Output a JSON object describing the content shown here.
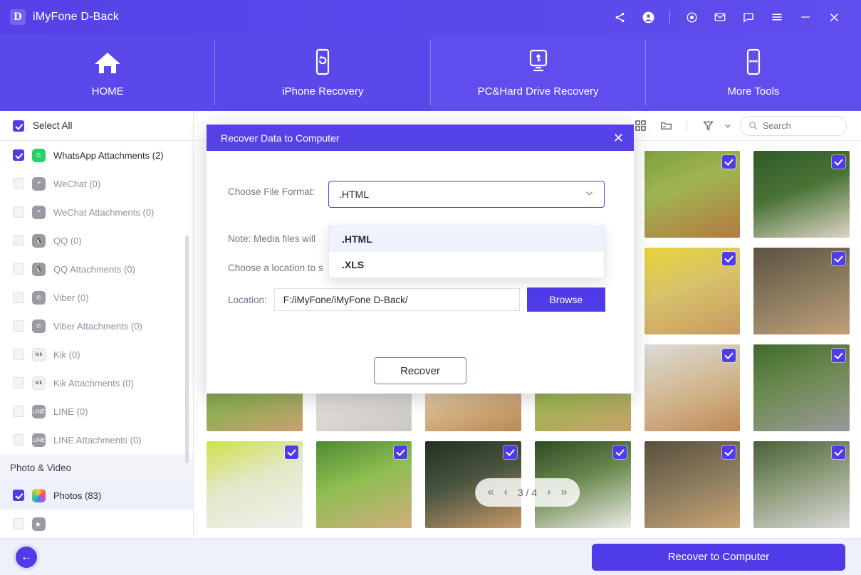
{
  "window": {
    "title": "iMyFone D-Back",
    "logo_letter": "D",
    "controls": [
      {
        "name": "share-icon"
      },
      {
        "name": "account-icon"
      },
      {
        "name": "target-icon"
      },
      {
        "name": "mail-icon"
      },
      {
        "name": "chat-icon"
      },
      {
        "name": "menu-icon"
      },
      {
        "name": "minimize-icon"
      },
      {
        "name": "close-icon"
      }
    ]
  },
  "nav": {
    "tabs": [
      {
        "label": "HOME",
        "icon": "home-icon",
        "active": true
      },
      {
        "label": "iPhone Recovery",
        "icon": "phone-refresh-icon",
        "active": false
      },
      {
        "label": "PC&Hard Drive Recovery",
        "icon": "monitor-key-icon",
        "active": false
      },
      {
        "label": "More Tools",
        "icon": "more-dots-icon",
        "active": false
      }
    ]
  },
  "sidebar": {
    "select_all_label": "Select All",
    "select_all_checked": true,
    "items": [
      {
        "label": "WhatsApp Attachments (2)",
        "checked": true,
        "enabled": true,
        "icon": "whatsapp-icon"
      },
      {
        "label": "WeChat (0)",
        "checked": false,
        "enabled": false,
        "icon": "wechat-icon"
      },
      {
        "label": "WeChat Attachments (0)",
        "checked": false,
        "enabled": false,
        "icon": "wechat-icon"
      },
      {
        "label": "QQ (0)",
        "checked": false,
        "enabled": false,
        "icon": "qq-icon"
      },
      {
        "label": "QQ Attachments (0)",
        "checked": false,
        "enabled": false,
        "icon": "qq-icon"
      },
      {
        "label": "Viber (0)",
        "checked": false,
        "enabled": false,
        "icon": "viber-icon"
      },
      {
        "label": "Viber Attachments (0)",
        "checked": false,
        "enabled": false,
        "icon": "viber-icon"
      },
      {
        "label": "Kik (0)",
        "checked": false,
        "enabled": false,
        "icon": "kik-icon"
      },
      {
        "label": "Kik Attachments (0)",
        "checked": false,
        "enabled": false,
        "icon": "kik-icon"
      },
      {
        "label": "LINE (0)",
        "checked": false,
        "enabled": false,
        "icon": "line-icon"
      },
      {
        "label": "LINE Attachments (0)",
        "checked": false,
        "enabled": false,
        "icon": "line-icon"
      }
    ],
    "group_label": "Photo & Video",
    "group_items": [
      {
        "label": "Photos (83)",
        "checked": true,
        "enabled": true,
        "selected": true,
        "icon": "photos-icon"
      }
    ]
  },
  "toolbar": {
    "grid_view_icon": "grid-view-icon",
    "folder_view_icon": "folder-view-icon",
    "filter_icon": "filter-icon",
    "search_placeholder": "Search",
    "search_value": ""
  },
  "grid": {
    "cells": [
      {
        "alt": "rabbit-in-grass",
        "checked": false,
        "c1": "#6e8f3a",
        "c2": "#c9a070"
      },
      {
        "alt": "rabbit-on-white",
        "checked": false,
        "c1": "#e8e8ea",
        "c2": "#c9c6c4"
      },
      {
        "alt": "rabbit-walking",
        "checked": false,
        "c1": "#f0efe9",
        "c2": "#b98950"
      },
      {
        "alt": "rabbit-in-meadow",
        "checked": false,
        "c1": "#7ea243",
        "c2": "#c8a06a"
      },
      {
        "alt": "deer-in-field",
        "checked": true,
        "c1": "#7fa03e",
        "c2": "#b5793f"
      },
      {
        "alt": "cat-and-kitten",
        "checked": true,
        "c1": "#2f5b27",
        "c2": "#ded5c6"
      },
      {
        "alt": "lop-rabbit-yellow-bg",
        "checked": true,
        "c1": "#e8d43a",
        "c2": "#c79a62"
      },
      {
        "alt": "rabbit-in-branches",
        "checked": true,
        "c1": "#5d5242",
        "c2": "#c2a07a"
      },
      {
        "alt": "rabbit-in-basket",
        "checked": true,
        "c1": "#dcdcd8",
        "c2": "#c08a55"
      },
      {
        "alt": "grey-rabbit-in-grass",
        "checked": true,
        "c1": "#3f6b2c",
        "c2": "#9a9a9a"
      },
      {
        "alt": "white-rabbit-laptop",
        "checked": true,
        "c1": "#cfe04a",
        "c2": "#f0f0ee"
      },
      {
        "alt": "rabbit-on-lawn",
        "checked": true,
        "c1": "#4e8a34",
        "c2": "#cfae7e"
      },
      {
        "alt": "rabbit-dark-bg",
        "checked": true,
        "c1": "#24301f",
        "c2": "#c79a6a"
      },
      {
        "alt": "white-rabbit-stump",
        "checked": true,
        "c1": "#2f4a22",
        "c2": "#ecebe7"
      },
      {
        "alt": "rabbit-twigs",
        "checked": true,
        "c1": "#5b4f3c",
        "c2": "#c9a472"
      },
      {
        "alt": "grey-white-rabbit",
        "checked": true,
        "c1": "#49603a",
        "c2": "#d8d8d6"
      }
    ]
  },
  "pagination": {
    "first_icon": "«",
    "prev_icon": "‹",
    "label": "3 / 4",
    "next_icon": "›",
    "last_icon": "»"
  },
  "bottom": {
    "back_icon": "←",
    "primary_label": "Recover to Computer"
  },
  "modal": {
    "title": "Recover Data to Computer",
    "close_icon": "✕",
    "file_format_label": "Choose File Format:",
    "file_format_value": ".HTML",
    "caret_icon": "⌄",
    "note_label": "Note: Media files will",
    "location_prompt_label": "Choose a location to s",
    "location_label": "Location:",
    "location_value": "F:/iMyFone/iMyFone D-Back/",
    "browse_label": "Browse",
    "recover_label": "Recover",
    "options": [
      {
        "label": ".HTML",
        "active": true
      },
      {
        "label": ".XLS",
        "active": false
      }
    ]
  },
  "colors": {
    "brand": "#5442e8",
    "brand_light": "#5f4eec",
    "accent": "#4f3ce8",
    "sidebar_selected": "#eef1fc",
    "bottom_bar": "#eef1fa"
  }
}
